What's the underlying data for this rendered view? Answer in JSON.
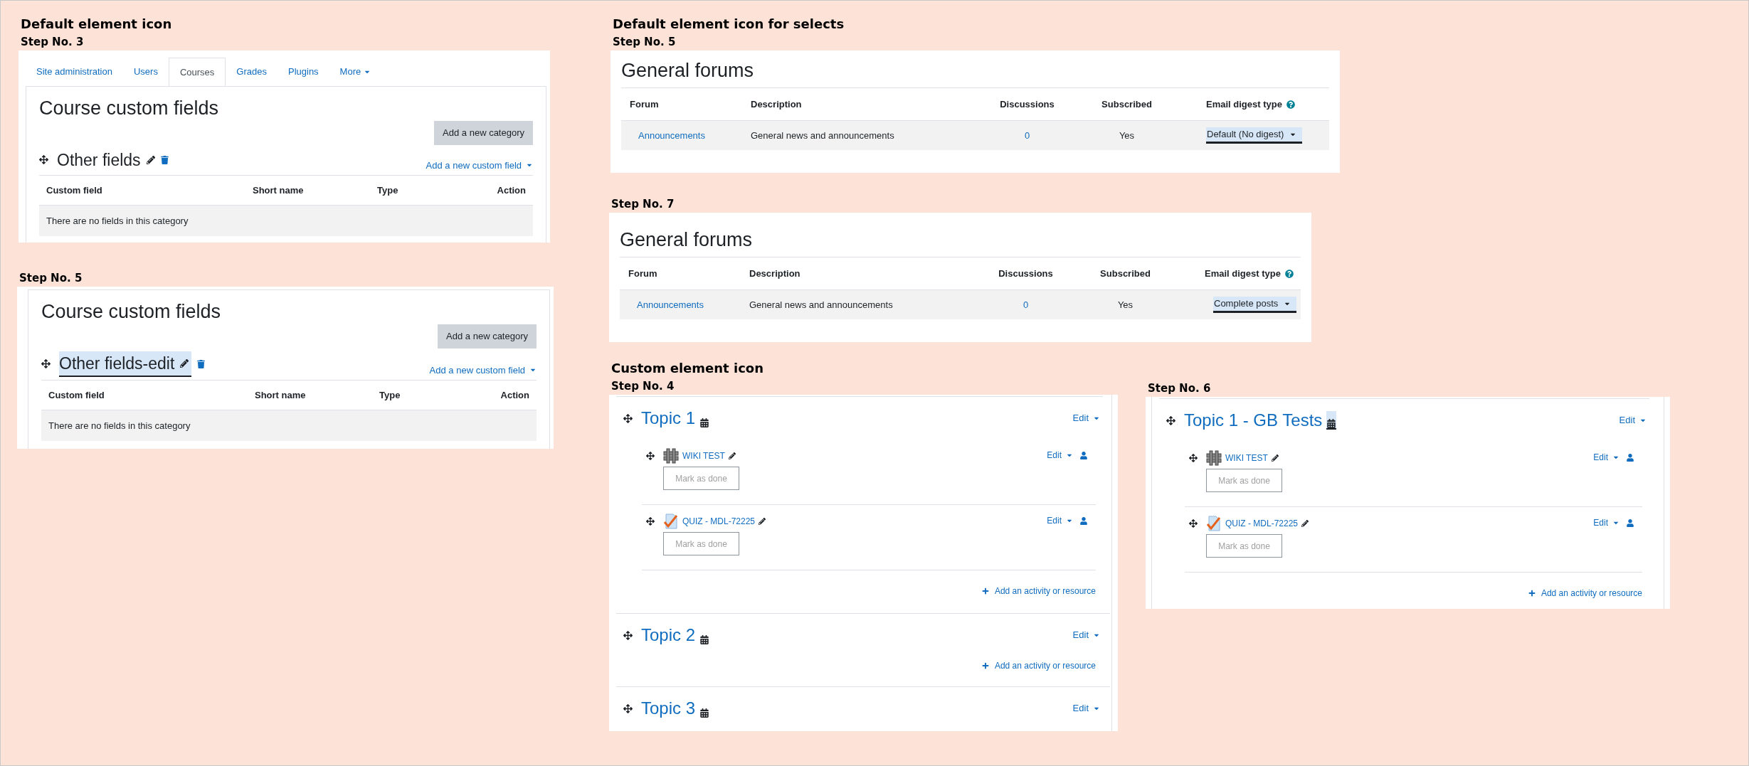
{
  "custom_fields_panels": [
    {
      "heading": "Default element icon",
      "step": "Step No. 3",
      "tabs": [
        {
          "label": "Site administration",
          "selected": false,
          "dropdown": false
        },
        {
          "label": "Users",
          "selected": false,
          "dropdown": false
        },
        {
          "label": "Courses",
          "selected": true,
          "dropdown": false
        },
        {
          "label": "Grades",
          "selected": false,
          "dropdown": false
        },
        {
          "label": "Plugins",
          "selected": false,
          "dropdown": false
        },
        {
          "label": "More",
          "selected": false,
          "dropdown": true
        }
      ],
      "title": "Course custom fields",
      "add_category": "Add a new category",
      "category": {
        "name": "Other fields",
        "editing": false
      },
      "add_field": "Add a new custom field",
      "columns": [
        "Custom field",
        "Short name",
        "Type",
        "Action"
      ],
      "empty_message": "There are no fields in this category"
    },
    {
      "step": "Step No. 5",
      "title": "Course custom fields",
      "add_category": "Add a new category",
      "category": {
        "name": "Other fields-edit",
        "editing": true
      },
      "add_field": "Add a new custom field",
      "columns": [
        "Custom field",
        "Short name",
        "Type",
        "Action"
      ],
      "empty_message": "There are no fields in this category"
    }
  ],
  "forum_panels": [
    {
      "heading": "Default element icon for selects",
      "step": "Step No. 5",
      "title": "General forums",
      "columns": [
        "Forum",
        "Description",
        "Discussions",
        "Subscribed",
        "Email digest type"
      ],
      "rows": [
        {
          "forum": "Announcements",
          "description": "General news and announcements",
          "discussions": "0",
          "subscribed": "Yes",
          "digest": "Default (No digest)",
          "digest_focused": true
        }
      ]
    },
    {
      "step": "Step No. 7",
      "title": "General forums",
      "columns": [
        "Forum",
        "Description",
        "Discussions",
        "Subscribed",
        "Email digest type"
      ],
      "rows": [
        {
          "forum": "Announcements",
          "description": "General news and announcements",
          "discussions": "0",
          "subscribed": "Yes",
          "digest": "Complete posts",
          "digest_focused": true
        }
      ]
    }
  ],
  "course_panels": [
    {
      "heading": "Custom element icon",
      "step": "Step No. 4",
      "topics": [
        {
          "title": "Topic 1",
          "icon_focused": false,
          "edit": "Edit",
          "activities": [
            {
              "kind": "wiki",
              "name": "WIKI TEST",
              "edit": "Edit",
              "completion": "Mark as done"
            },
            {
              "kind": "quiz",
              "name": "QUIZ - MDL-72225",
              "edit": "Edit",
              "completion": "Mark as done"
            }
          ],
          "add_activity": "Add an activity or resource"
        },
        {
          "title": "Topic 2",
          "icon_focused": false,
          "edit": "Edit",
          "add_activity": "Add an activity or resource"
        },
        {
          "title": "Topic 3",
          "icon_focused": false,
          "edit": "Edit"
        }
      ]
    },
    {
      "step": "Step No. 6",
      "topics": [
        {
          "title": "Topic 1 - GB Tests",
          "icon_focused": true,
          "edit": "Edit",
          "activities": [
            {
              "kind": "wiki",
              "name": "WIKI TEST",
              "edit": "Edit",
              "completion": "Mark as done"
            },
            {
              "kind": "quiz",
              "name": "QUIZ - MDL-72225",
              "edit": "Edit",
              "completion": "Mark as done"
            }
          ],
          "add_activity": "Add an activity or resource"
        }
      ]
    }
  ]
}
